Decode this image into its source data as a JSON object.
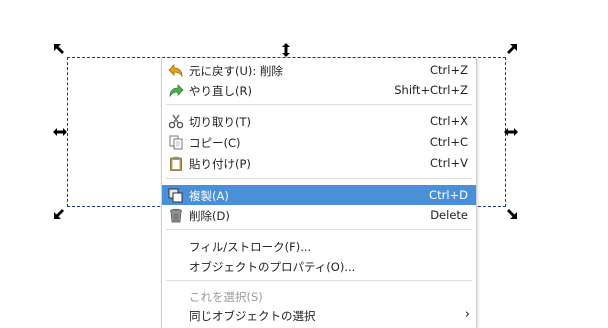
{
  "menu": {
    "items": [
      {
        "label": "元に戻す(U): 削除",
        "accel": "Ctrl+Z",
        "icon": "undo-icon"
      },
      {
        "label": "やり直し(R)",
        "accel": "Shift+Ctrl+Z",
        "icon": "redo-icon"
      },
      {
        "label": "切り取り(T)",
        "accel": "Ctrl+X",
        "icon": "scissors-icon"
      },
      {
        "label": "コピー(C)",
        "accel": "Ctrl+C",
        "icon": "copy-icon"
      },
      {
        "label": "貼り付け(P)",
        "accel": "Ctrl+V",
        "icon": "paste-icon"
      },
      {
        "label": "複製(A)",
        "accel": "Ctrl+D",
        "icon": "duplicate-icon",
        "state": "highlighted"
      },
      {
        "label": "削除(D)",
        "accel": "Delete",
        "icon": "trash-icon"
      },
      {
        "label": "フィル/ストローク(F)..."
      },
      {
        "label": "オブジェクトのプロパティ(O)..."
      },
      {
        "label": "これを選択(S)",
        "state": "disabled"
      },
      {
        "label": "同じオブジェクトの選択",
        "submenu_arrow": "›"
      }
    ]
  },
  "colors": {
    "highlight": "#4a90d9",
    "selection_dash": "#1a3a8a"
  }
}
